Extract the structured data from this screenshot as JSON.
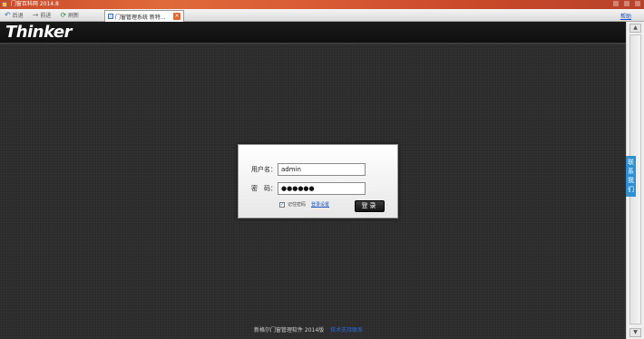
{
  "window": {
    "title": "门窗百科网 2014.8"
  },
  "toolbar": {
    "back_label": "后退",
    "forward_label": "前进",
    "refresh_label": "刷新",
    "tab_label": "门窗管理系统 新特...",
    "right_link": "帮助"
  },
  "site": {
    "logo": "Thinker"
  },
  "side_tab": {
    "label": "联系我们"
  },
  "login": {
    "username_label": "用户名：",
    "username_value": "admin",
    "password_label": "密　码：",
    "password_value": "●●●●●●",
    "remember_check": "✓",
    "remember_label": "记住密码",
    "settings_link": "登录设置",
    "submit_label": "登录"
  },
  "footer": {
    "text": "新格尔门窗管理软件 2014版",
    "link": "技术支持联系"
  },
  "colors": {
    "background": "#2a2a2a",
    "header": "#141414",
    "accent_blue": "#2f8fd1",
    "titlebar": "#d85a35"
  }
}
